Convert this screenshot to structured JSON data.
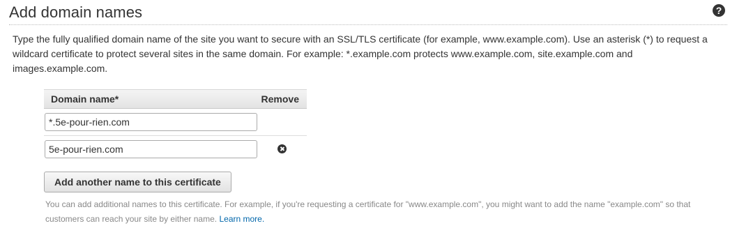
{
  "header": {
    "title": "Add domain names",
    "help_icon": "question-circle-icon",
    "help_glyph": "?"
  },
  "description": "Type the fully qualified domain name of the site you want to secure with an SSL/TLS certificate (for example, www.example.com). Use an asterisk (*) to request a wildcard certificate to protect several sites in the same domain. For example: *.example.com protects www.example.com, site.example.com and images.example.com.",
  "table": {
    "columns": [
      "Domain name*",
      "Remove"
    ],
    "rows": [
      {
        "domain": "*.5e-pour-rien.com",
        "removable": false
      },
      {
        "domain": "5e-pour-rien.com",
        "removable": true,
        "remove_icon": "remove-circle-icon"
      }
    ]
  },
  "add_button_label": "Add another name to this certificate",
  "hint": {
    "text": "You can add additional names to this certificate. For example, if you're requesting a certificate for \"www.example.com\", you might want to add the name \"example.com\" so that customers can reach your site by either name.",
    "link_label": "Learn more."
  },
  "colors": {
    "text": "#333333",
    "hint": "#888888",
    "link": "#0066aa"
  }
}
